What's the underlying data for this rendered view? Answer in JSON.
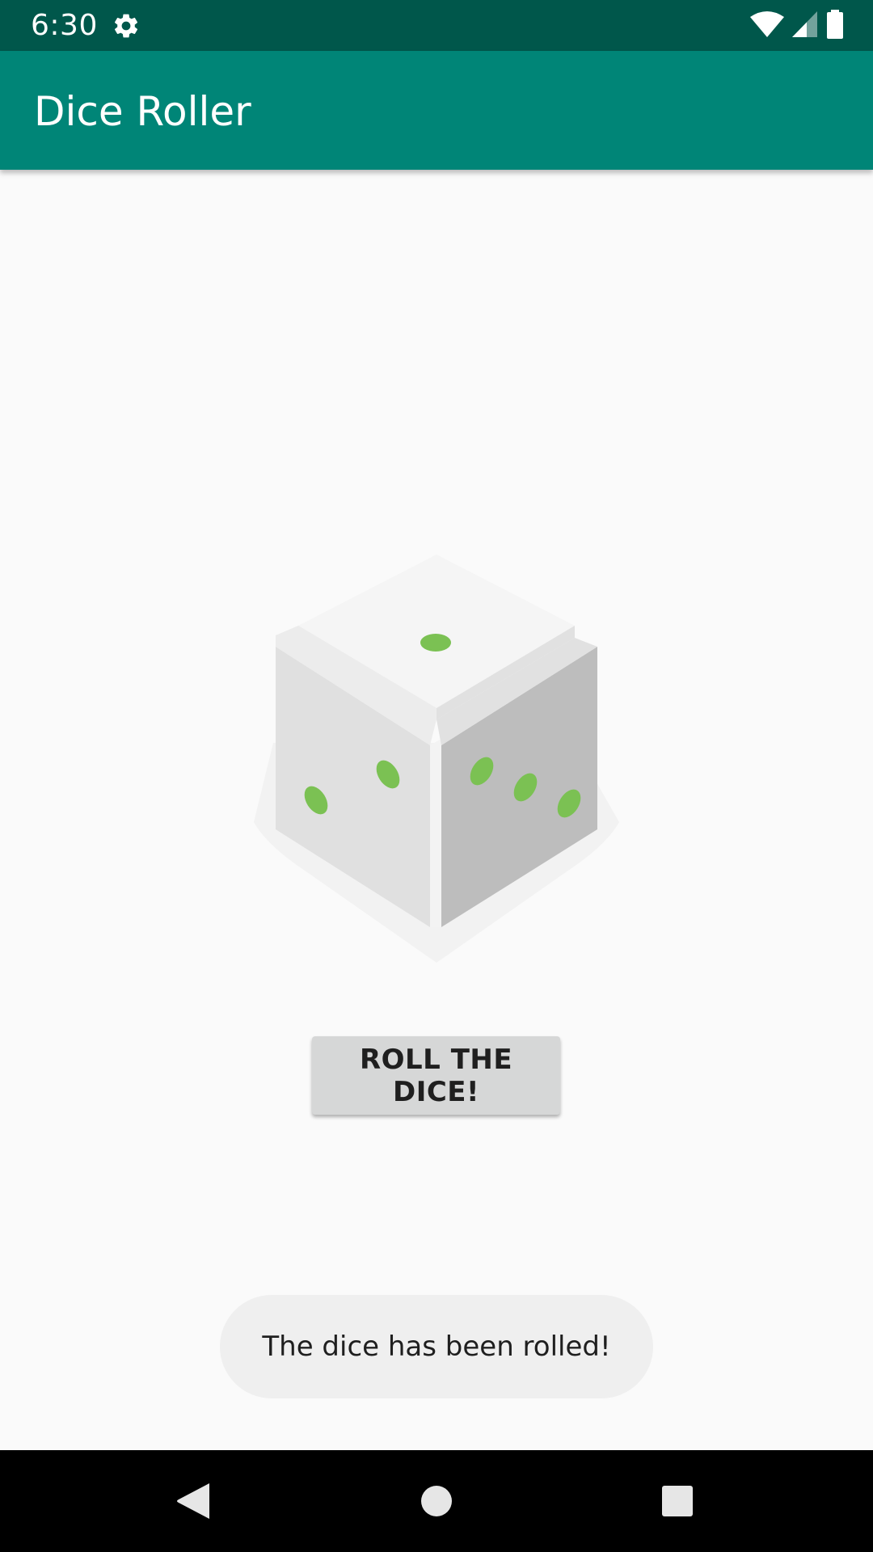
{
  "status_bar": {
    "time": "6:30",
    "icons": [
      "gear-icon",
      "wifi-icon",
      "cell-signal-icon",
      "battery-icon"
    ]
  },
  "app_bar": {
    "title": "Dice Roller",
    "color": "#008577",
    "status_color": "#00574b"
  },
  "dice": {
    "icon": "dice-icon",
    "pip_color": "#7bc153",
    "top_face": 1,
    "left_face": 2,
    "right_face": 3
  },
  "roll_button": {
    "label": "ROLL THE DICE!"
  },
  "toast": {
    "message": "The dice has been rolled!"
  },
  "nav_bar": {
    "items": [
      "back-icon",
      "home-icon",
      "recents-icon"
    ]
  }
}
